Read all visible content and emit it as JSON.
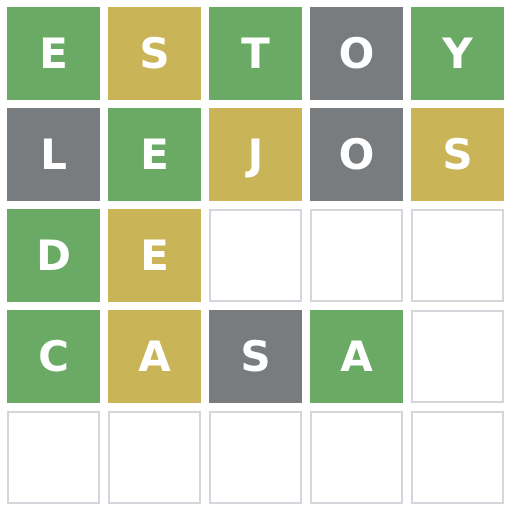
{
  "colors": {
    "correct": "#6aaa64",
    "present": "#c9b458",
    "absent": "#787c7e",
    "empty_border": "#d3d6da"
  },
  "rows": [
    {
      "tiles": [
        {
          "letter": "E",
          "state": "correct"
        },
        {
          "letter": "S",
          "state": "present"
        },
        {
          "letter": "T",
          "state": "correct"
        },
        {
          "letter": "O",
          "state": "absent"
        },
        {
          "letter": "Y",
          "state": "correct"
        }
      ]
    },
    {
      "tiles": [
        {
          "letter": "L",
          "state": "absent"
        },
        {
          "letter": "E",
          "state": "correct"
        },
        {
          "letter": "J",
          "state": "present"
        },
        {
          "letter": "O",
          "state": "absent"
        },
        {
          "letter": "S",
          "state": "present"
        }
      ]
    },
    {
      "tiles": [
        {
          "letter": "D",
          "state": "correct"
        },
        {
          "letter": "E",
          "state": "present"
        },
        {
          "letter": "",
          "state": "empty"
        },
        {
          "letter": "",
          "state": "empty"
        },
        {
          "letter": "",
          "state": "empty"
        }
      ]
    },
    {
      "tiles": [
        {
          "letter": "C",
          "state": "correct"
        },
        {
          "letter": "A",
          "state": "present"
        },
        {
          "letter": "S",
          "state": "absent"
        },
        {
          "letter": "A",
          "state": "correct"
        },
        {
          "letter": "",
          "state": "empty"
        }
      ]
    },
    {
      "tiles": [
        {
          "letter": "",
          "state": "empty"
        },
        {
          "letter": "",
          "state": "empty"
        },
        {
          "letter": "",
          "state": "empty"
        },
        {
          "letter": "",
          "state": "empty"
        },
        {
          "letter": "",
          "state": "empty"
        }
      ]
    }
  ]
}
